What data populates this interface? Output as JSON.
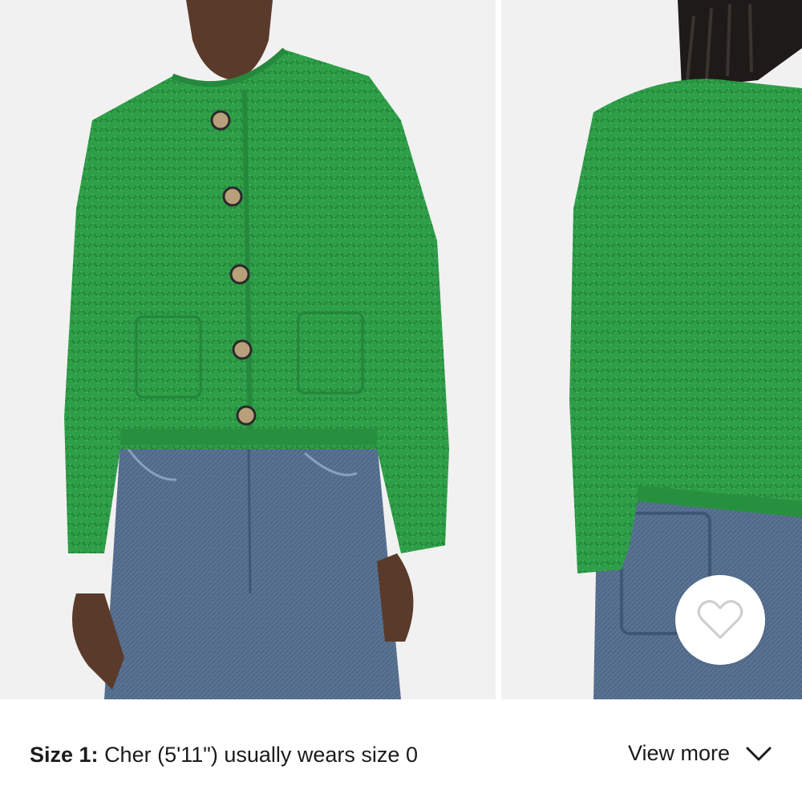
{
  "gallery": {
    "images": [
      {
        "alt": "front-view-photo"
      },
      {
        "alt": "back-view-photo"
      }
    ]
  },
  "wishlist": {
    "icon": "heart-icon"
  },
  "size_info": {
    "label": "Size 1:",
    "text": "Cher (5'11\") usually wears size 0"
  },
  "view_more": {
    "label": "View more",
    "icon": "chevron-down-icon"
  },
  "colors": {
    "cardigan_green": "#2f9e48",
    "denim_blue": "#5a7393",
    "text": "#1b1b1b",
    "background": "#ffffff"
  }
}
